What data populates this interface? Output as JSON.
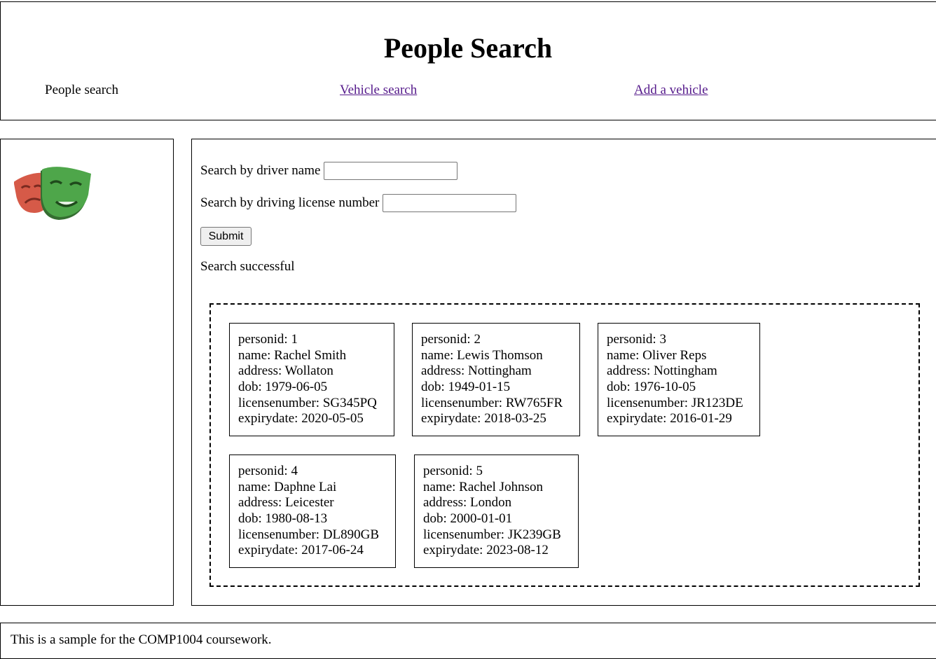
{
  "header": {
    "title": "People Search",
    "nav": [
      {
        "label": "People search"
      },
      {
        "label": "Vehicle search"
      },
      {
        "label": "Add a vehicle"
      }
    ]
  },
  "sidebar": {
    "logo_icon": "theatre-masks-icon",
    "colors": {
      "red_mask": "#d65a48",
      "green_mask": "#4ea64a"
    }
  },
  "form": {
    "driver_name_label": "Search by driver name",
    "driver_name_value": "",
    "license_label": "Search by driving license number",
    "license_value": "",
    "submit_label": "Submit",
    "status": "Search successful"
  },
  "results": [
    {
      "personid": "personid: 1",
      "name": "name: Rachel Smith",
      "address": "address: Wollaton",
      "dob": "dob: 1979-06-05",
      "licensenumber": "licensenumber: SG345PQ",
      "expirydate": "expirydate: 2020-05-05"
    },
    {
      "personid": "personid: 2",
      "name": "name: Lewis Thomson",
      "address": "address: Nottingham",
      "dob": "dob: 1949-01-15",
      "licensenumber": "licensenumber: RW765FR",
      "expirydate": "expirydate: 2018-03-25"
    },
    {
      "personid": "personid: 3",
      "name": "name: Oliver Reps",
      "address": "address: Nottingham",
      "dob": "dob: 1976-10-05",
      "licensenumber": "licensenumber: JR123DE",
      "expirydate": "expirydate: 2016-01-29"
    },
    {
      "personid": "personid: 4",
      "name": "name: Daphne Lai",
      "address": "address: Leicester",
      "dob": "dob: 1980-08-13",
      "licensenumber": "licensenumber: DL890GB",
      "expirydate": "expirydate: 2017-06-24"
    },
    {
      "personid": "personid: 5",
      "name": "name: Rachel Johnson",
      "address": "address: London",
      "dob": "dob: 2000-01-01",
      "licensenumber": "licensenumber: JK239GB",
      "expirydate": "expirydate: 2023-08-12"
    }
  ],
  "footer": {
    "text": "This is a sample for the COMP1004 coursework."
  }
}
